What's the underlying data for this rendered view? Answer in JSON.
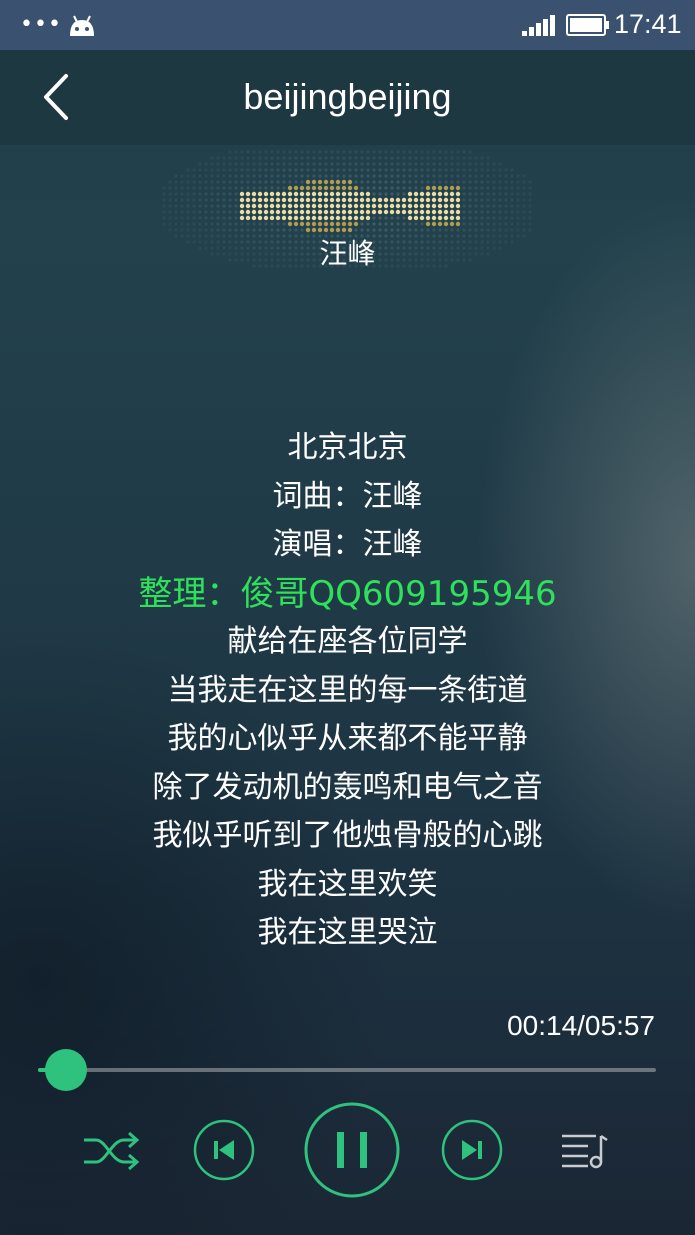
{
  "status_bar": {
    "dots": "•••",
    "time": "17:41",
    "icons": [
      "android-notification-icon",
      "signal-icon",
      "battery-icon"
    ]
  },
  "header": {
    "title": "beijingbeijing",
    "back_icon": "chevron-left-icon"
  },
  "artist": {
    "name": "汪峰"
  },
  "lyrics": {
    "lines": [
      "北京北京",
      "词曲：汪峰",
      "演唱：汪峰",
      "整理：俊哥QQ609195946",
      "献给在座各位同学",
      "当我走在这里的每一条街道",
      "我的心似乎从来都不能平静",
      "除了发动机的轰鸣和电气之音",
      "我似乎听到了他烛骨般的心跳",
      "我在这里欢笑",
      "我在这里哭泣"
    ],
    "highlight_index": 3
  },
  "playback": {
    "elapsed": "00:14",
    "total": "05:57",
    "time_display": "00:14/05:57",
    "progress_fraction": 0.04,
    "state": "playing"
  },
  "controls": {
    "shuffle_icon": "shuffle-icon",
    "prev_icon": "skip-previous-icon",
    "pause_icon": "pause-icon",
    "next_icon": "skip-next-icon",
    "playlist_icon": "playlist-icon"
  },
  "colors": {
    "accent": "#2ec27e",
    "highlight_lyric": "#2fe05a",
    "status_bar": "#3a5270"
  }
}
